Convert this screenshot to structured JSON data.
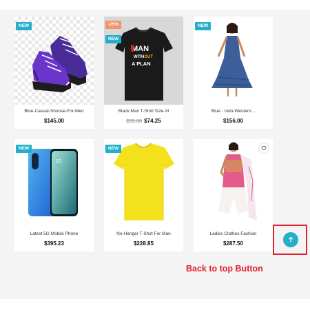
{
  "products": [
    {
      "name": "Blue-Casual-Shoose-For-Men",
      "price": "$145.00",
      "old_price": "",
      "badges": [
        "NEW"
      ],
      "icon": "purple-sneakers-image"
    },
    {
      "name": "Black Man T-Shirt Size-Xl",
      "price": "$74.25",
      "old_price": "$99.00",
      "badges": [
        "-25%",
        "NEW"
      ],
      "icon": "black-tshirt-image",
      "print_text": {
        "line1": "MAN",
        "line2a": "WITH",
        "line2b": "OUT",
        "line3": "A PLAN"
      }
    },
    {
      "name": "Blue - Indo-Western...",
      "price": "$156.00",
      "old_price": "",
      "badges": [
        "NEW"
      ],
      "icon": "blue-dress-image"
    },
    {
      "name": "Latest 5G Mobile Phone",
      "price": "$395.23",
      "old_price": "",
      "badges": [
        "NEW"
      ],
      "icon": "mobile-phone-image"
    },
    {
      "name": "No-Hanger T-Shirt For Man",
      "price": "$228.85",
      "old_price": "",
      "badges": [
        "NEW"
      ],
      "icon": "yellow-tshirt-image"
    },
    {
      "name": "Ladies Clothes Fashion",
      "price": "$287.50",
      "old_price": "",
      "badges": [],
      "icon": "pink-salwar-image"
    }
  ],
  "wishlist_icon": "heart-icon",
  "back_to_top": {
    "icon": "arrow-up-icon",
    "annotation": "Back to top Button"
  },
  "colors": {
    "accent": "#25aeca",
    "sale": "#f5936b",
    "annotation": "#e0242e",
    "background": "#f4f4f4"
  }
}
